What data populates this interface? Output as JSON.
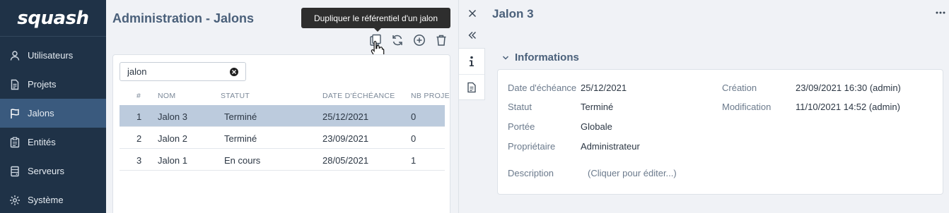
{
  "app": {
    "logo_text": "squash"
  },
  "sidebar": {
    "items": [
      {
        "label": "Utilisateurs",
        "icon": "user-icon",
        "active": false
      },
      {
        "label": "Projets",
        "icon": "document-icon",
        "active": false
      },
      {
        "label": "Jalons",
        "icon": "flag-icon",
        "active": true
      },
      {
        "label": "Entités",
        "icon": "clipboard-icon",
        "active": false
      },
      {
        "label": "Serveurs",
        "icon": "server-icon",
        "active": false
      },
      {
        "label": "Système",
        "icon": "gear-icon",
        "active": false
      }
    ]
  },
  "main": {
    "title": "Administration - Jalons",
    "tooltip": "Dupliquer le référentiel d'un jalon",
    "toolbar": [
      "duplicate-icon",
      "sync-icon",
      "add-circle-icon",
      "trash-icon"
    ],
    "search": {
      "value": "jalon"
    },
    "table": {
      "columns": [
        "#",
        "NOM",
        "STATUT",
        "DATE D'ÉCHÉANCE",
        "NB PROJE"
      ],
      "rows": [
        {
          "num": "1",
          "name": "Jalon 3",
          "status": "Terminé",
          "date": "25/12/2021",
          "projects": "0",
          "selected": true
        },
        {
          "num": "2",
          "name": "Jalon 2",
          "status": "Terminé",
          "date": "23/09/2021",
          "projects": "0",
          "selected": false
        },
        {
          "num": "3",
          "name": "Jalon 1",
          "status": "En cours",
          "date": "28/05/2021",
          "projects": "1",
          "selected": false
        }
      ]
    }
  },
  "detail": {
    "title": "Jalon 3",
    "section_title": "Informations",
    "fields": {
      "due_date_label": "Date d'échéance",
      "due_date": "25/12/2021",
      "status_label": "Statut",
      "status": "Terminé",
      "scope_label": "Portée",
      "scope": "Globale",
      "owner_label": "Propriétaire",
      "owner": "Administrateur",
      "description_label": "Description",
      "description": "(Cliquer pour éditer...)",
      "created_label": "Création",
      "created": "23/09/2021 16:30 (admin)",
      "modified_label": "Modification",
      "modified": "11/10/2021 14:52 (admin)"
    }
  },
  "colors": {
    "sidebar_bg": "#1f3247",
    "sidebar_active": "#3a5a7e",
    "selected_row": "#bccbdd",
    "title": "#4a607a"
  }
}
